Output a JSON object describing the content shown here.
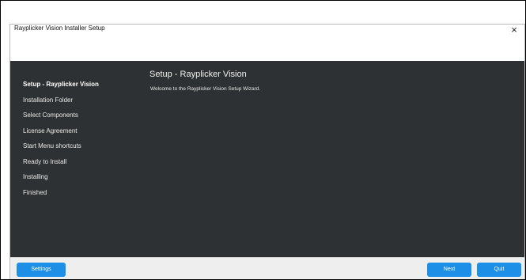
{
  "window": {
    "title": "Rayplicker Vision Installer Setup",
    "close_glyph": "×"
  },
  "sidebar": {
    "steps": [
      {
        "label": "Setup - Rayplicker Vision",
        "active": true
      },
      {
        "label": "Installation Folder",
        "active": false
      },
      {
        "label": "Select Components",
        "active": false
      },
      {
        "label": "License Agreement",
        "active": false
      },
      {
        "label": "Start Menu shortcuts",
        "active": false
      },
      {
        "label": "Ready to Install",
        "active": false
      },
      {
        "label": "Installing",
        "active": false
      },
      {
        "label": "Finished",
        "active": false
      }
    ]
  },
  "content": {
    "title": "Setup - Rayplicker Vision",
    "text": "Welcome to the Rayplicker Vision Setup Wizard."
  },
  "footer": {
    "settings_label": "Settings",
    "next_label": "Next",
    "quit_label": "Quit"
  },
  "colors": {
    "panel_bg": "#2e3133",
    "button_bg": "#1e8fe6",
    "footer_bg": "#eeeeee"
  }
}
